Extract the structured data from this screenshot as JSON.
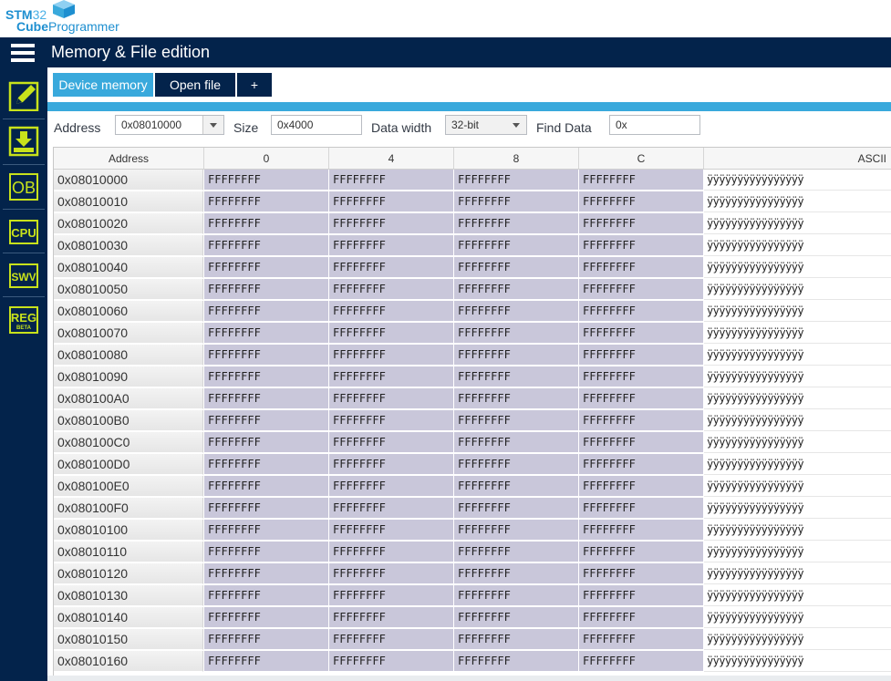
{
  "app": {
    "logo_line1_bold": "STM",
    "logo_line1_thin": "32",
    "logo_line2_bold": "Cube",
    "logo_line2_rest": "Programmer",
    "title": "Memory & File edition"
  },
  "sidebar": {
    "items": [
      {
        "icon": "pencil-edit-icon",
        "label": ""
      },
      {
        "icon": "download-icon",
        "label": ""
      },
      {
        "icon": "ob-icon",
        "label": "OB"
      },
      {
        "icon": "cpu-icon",
        "label": "CPU"
      },
      {
        "icon": "swv-icon",
        "label": "SWV"
      },
      {
        "icon": "reg-icon",
        "label": "REG",
        "sublabel": "BETA"
      }
    ]
  },
  "tabs": [
    {
      "label": "Device memory",
      "active": true
    },
    {
      "label": "Open file",
      "active": false
    },
    {
      "label": "+",
      "active": false
    }
  ],
  "toolbar": {
    "address_label": "Address",
    "address_value": "0x08010000",
    "size_label": "Size",
    "size_value": "0x4000",
    "data_width_label": "Data width",
    "data_width_value": "32-bit",
    "find_label": "Find Data",
    "find_value": "0x"
  },
  "grid": {
    "headers": [
      "Address",
      "0",
      "4",
      "8",
      "C",
      "ASCII"
    ],
    "rows": [
      {
        "address": "0x08010000",
        "values": [
          "FFFFFFFF",
          "FFFFFFFF",
          "FFFFFFFF",
          "FFFFFFFF"
        ],
        "ascii": "ÿÿÿÿÿÿÿÿÿÿÿÿÿÿÿÿ"
      },
      {
        "address": "0x08010010",
        "values": [
          "FFFFFFFF",
          "FFFFFFFF",
          "FFFFFFFF",
          "FFFFFFFF"
        ],
        "ascii": "ÿÿÿÿÿÿÿÿÿÿÿÿÿÿÿÿ"
      },
      {
        "address": "0x08010020",
        "values": [
          "FFFFFFFF",
          "FFFFFFFF",
          "FFFFFFFF",
          "FFFFFFFF"
        ],
        "ascii": "ÿÿÿÿÿÿÿÿÿÿÿÿÿÿÿÿ"
      },
      {
        "address": "0x08010030",
        "values": [
          "FFFFFFFF",
          "FFFFFFFF",
          "FFFFFFFF",
          "FFFFFFFF"
        ],
        "ascii": "ÿÿÿÿÿÿÿÿÿÿÿÿÿÿÿÿ"
      },
      {
        "address": "0x08010040",
        "values": [
          "FFFFFFFF",
          "FFFFFFFF",
          "FFFFFFFF",
          "FFFFFFFF"
        ],
        "ascii": "ÿÿÿÿÿÿÿÿÿÿÿÿÿÿÿÿ"
      },
      {
        "address": "0x08010050",
        "values": [
          "FFFFFFFF",
          "FFFFFFFF",
          "FFFFFFFF",
          "FFFFFFFF"
        ],
        "ascii": "ÿÿÿÿÿÿÿÿÿÿÿÿÿÿÿÿ"
      },
      {
        "address": "0x08010060",
        "values": [
          "FFFFFFFF",
          "FFFFFFFF",
          "FFFFFFFF",
          "FFFFFFFF"
        ],
        "ascii": "ÿÿÿÿÿÿÿÿÿÿÿÿÿÿÿÿ"
      },
      {
        "address": "0x08010070",
        "values": [
          "FFFFFFFF",
          "FFFFFFFF",
          "FFFFFFFF",
          "FFFFFFFF"
        ],
        "ascii": "ÿÿÿÿÿÿÿÿÿÿÿÿÿÿÿÿ"
      },
      {
        "address": "0x08010080",
        "values": [
          "FFFFFFFF",
          "FFFFFFFF",
          "FFFFFFFF",
          "FFFFFFFF"
        ],
        "ascii": "ÿÿÿÿÿÿÿÿÿÿÿÿÿÿÿÿ"
      },
      {
        "address": "0x08010090",
        "values": [
          "FFFFFFFF",
          "FFFFFFFF",
          "FFFFFFFF",
          "FFFFFFFF"
        ],
        "ascii": "ÿÿÿÿÿÿÿÿÿÿÿÿÿÿÿÿ"
      },
      {
        "address": "0x080100A0",
        "values": [
          "FFFFFFFF",
          "FFFFFFFF",
          "FFFFFFFF",
          "FFFFFFFF"
        ],
        "ascii": "ÿÿÿÿÿÿÿÿÿÿÿÿÿÿÿÿ"
      },
      {
        "address": "0x080100B0",
        "values": [
          "FFFFFFFF",
          "FFFFFFFF",
          "FFFFFFFF",
          "FFFFFFFF"
        ],
        "ascii": "ÿÿÿÿÿÿÿÿÿÿÿÿÿÿÿÿ"
      },
      {
        "address": "0x080100C0",
        "values": [
          "FFFFFFFF",
          "FFFFFFFF",
          "FFFFFFFF",
          "FFFFFFFF"
        ],
        "ascii": "ÿÿÿÿÿÿÿÿÿÿÿÿÿÿÿÿ"
      },
      {
        "address": "0x080100D0",
        "values": [
          "FFFFFFFF",
          "FFFFFFFF",
          "FFFFFFFF",
          "FFFFFFFF"
        ],
        "ascii": "ÿÿÿÿÿÿÿÿÿÿÿÿÿÿÿÿ"
      },
      {
        "address": "0x080100E0",
        "values": [
          "FFFFFFFF",
          "FFFFFFFF",
          "FFFFFFFF",
          "FFFFFFFF"
        ],
        "ascii": "ÿÿÿÿÿÿÿÿÿÿÿÿÿÿÿÿ"
      },
      {
        "address": "0x080100F0",
        "values": [
          "FFFFFFFF",
          "FFFFFFFF",
          "FFFFFFFF",
          "FFFFFFFF"
        ],
        "ascii": "ÿÿÿÿÿÿÿÿÿÿÿÿÿÿÿÿ"
      },
      {
        "address": "0x08010100",
        "values": [
          "FFFFFFFF",
          "FFFFFFFF",
          "FFFFFFFF",
          "FFFFFFFF"
        ],
        "ascii": "ÿÿÿÿÿÿÿÿÿÿÿÿÿÿÿÿ"
      },
      {
        "address": "0x08010110",
        "values": [
          "FFFFFFFF",
          "FFFFFFFF",
          "FFFFFFFF",
          "FFFFFFFF"
        ],
        "ascii": "ÿÿÿÿÿÿÿÿÿÿÿÿÿÿÿÿ"
      },
      {
        "address": "0x08010120",
        "values": [
          "FFFFFFFF",
          "FFFFFFFF",
          "FFFFFFFF",
          "FFFFFFFF"
        ],
        "ascii": "ÿÿÿÿÿÿÿÿÿÿÿÿÿÿÿÿ"
      },
      {
        "address": "0x08010130",
        "values": [
          "FFFFFFFF",
          "FFFFFFFF",
          "FFFFFFFF",
          "FFFFFFFF"
        ],
        "ascii": "ÿÿÿÿÿÿÿÿÿÿÿÿÿÿÿÿ"
      },
      {
        "address": "0x08010140",
        "values": [
          "FFFFFFFF",
          "FFFFFFFF",
          "FFFFFFFF",
          "FFFFFFFF"
        ],
        "ascii": "ÿÿÿÿÿÿÿÿÿÿÿÿÿÿÿÿ"
      },
      {
        "address": "0x08010150",
        "values": [
          "FFFFFFFF",
          "FFFFFFFF",
          "FFFFFFFF",
          "FFFFFFFF"
        ],
        "ascii": "ÿÿÿÿÿÿÿÿÿÿÿÿÿÿÿÿ"
      },
      {
        "address": "0x08010160",
        "values": [
          "FFFFFFFF",
          "FFFFFFFF",
          "FFFFFFFF",
          "FFFFFFFF"
        ],
        "ascii": "ÿÿÿÿÿÿÿÿÿÿÿÿÿÿÿÿ"
      }
    ]
  },
  "colors": {
    "navy": "#03234b",
    "accent_blue": "#39a9dc",
    "icon_green": "#c8e21b",
    "hex_cell": "#c9c7da"
  }
}
